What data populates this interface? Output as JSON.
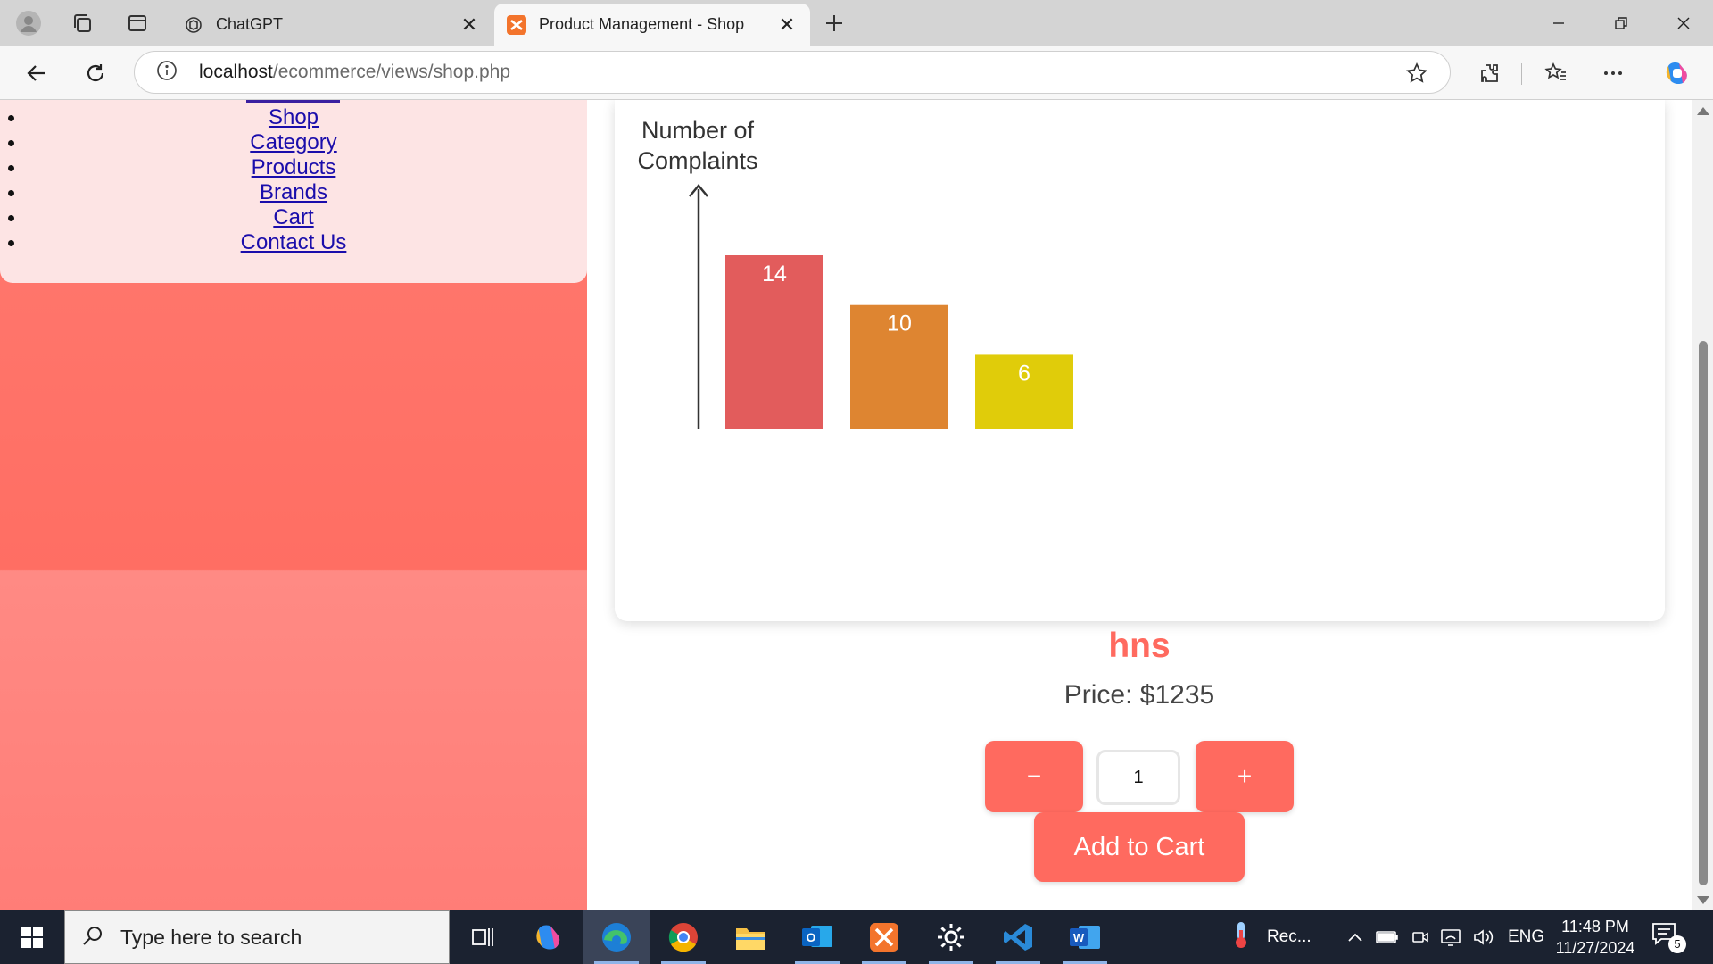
{
  "browser": {
    "tabs": [
      {
        "title": "ChatGPT",
        "active": false
      },
      {
        "title": "Product Management - Shop",
        "active": true
      }
    ],
    "close_glyph": "✕",
    "url_host": "localhost",
    "url_path": "/ecommerce/views/shop.php"
  },
  "nav": {
    "items": [
      "Shop",
      "Category",
      "Products",
      "Brands",
      "Cart",
      "Contact Us"
    ]
  },
  "chart_data": {
    "type": "bar",
    "ylabel": "Number of Complaints",
    "ylabel_lines": [
      "Number of",
      "Complaints"
    ],
    "values": [
      14,
      10,
      6
    ],
    "colors": [
      "#e25c5c",
      "#de8531",
      "#e0cc0a"
    ],
    "ylim": [
      0,
      14
    ],
    "grid": false
  },
  "product": {
    "name": "hns",
    "price": "Price: $1235",
    "minus_label": "−",
    "plus_label": "+",
    "quantity": "1",
    "add_to_cart_label": "Add to Cart"
  },
  "taskbar": {
    "search_placeholder": "Type here to search",
    "weather_label": "Rec...",
    "lang": "ENG",
    "time": "11:48 PM",
    "date": "11/27/2024",
    "notification_count": "5"
  },
  "colors": {
    "accent": "#ff6a5f",
    "nav_bg": "#fde4e4",
    "link": "#1a0dab",
    "taskbar": "#1b2230"
  }
}
